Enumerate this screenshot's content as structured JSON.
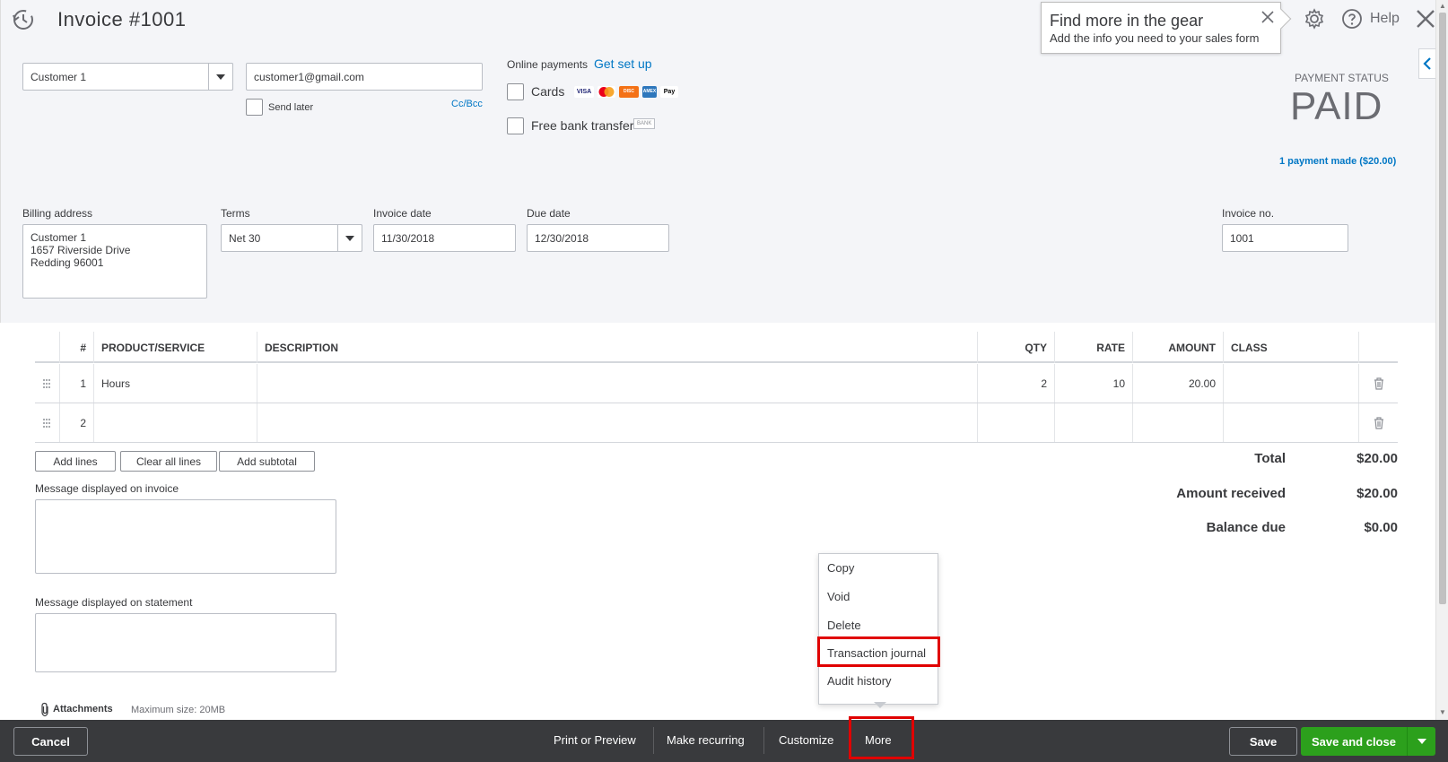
{
  "header": {
    "title": "Invoice #1001",
    "help_label": "Help"
  },
  "tooltip": {
    "title": "Find more in the gear",
    "body": "Add the info you need to your sales form"
  },
  "customer": {
    "selected": "Customer 1",
    "email": "customer1@gmail.com",
    "send_later_label": "Send later",
    "cc_bcc_label": "Cc/Bcc"
  },
  "online_payments": {
    "label": "Online payments",
    "setup_link": "Get set up",
    "cards_label": "Cards",
    "card_logos": [
      "VISA",
      "MC",
      "DISC",
      "AMEX",
      "Pay"
    ],
    "bank_label": "Free bank transfer",
    "bank_badge": "BANK"
  },
  "payment_status": {
    "label": "PAYMENT STATUS",
    "value": "PAID",
    "payments_link": "1 payment made ($20.00)"
  },
  "fields": {
    "billing_address_label": "Billing address",
    "billing_address_lines": [
      "Customer 1",
      "1657 Riverside Drive",
      "Redding  96001"
    ],
    "terms_label": "Terms",
    "terms_value": "Net 30",
    "invoice_date_label": "Invoice date",
    "invoice_date_value": "11/30/2018",
    "due_date_label": "Due date",
    "due_date_value": "12/30/2018",
    "invoice_no_label": "Invoice no.",
    "invoice_no_value": "1001"
  },
  "table": {
    "headers": {
      "num": "#",
      "product": "PRODUCT/SERVICE",
      "description": "DESCRIPTION",
      "qty": "QTY",
      "rate": "RATE",
      "amount": "AMOUNT",
      "class": "CLASS"
    },
    "rows": [
      {
        "num": "1",
        "product": "Hours",
        "description": "",
        "qty": "2",
        "rate": "10",
        "amount": "20.00",
        "class": ""
      },
      {
        "num": "2",
        "product": "",
        "description": "",
        "qty": "",
        "rate": "",
        "amount": "",
        "class": ""
      }
    ]
  },
  "line_buttons": {
    "add_lines": "Add lines",
    "clear_all_lines": "Clear all lines",
    "add_subtotal": "Add subtotal"
  },
  "messages": {
    "invoice_label": "Message displayed on invoice",
    "statement_label": "Message displayed on statement"
  },
  "attachments": {
    "label": "Attachments",
    "max_size": "Maximum size: 20MB"
  },
  "totals": {
    "total_label": "Total",
    "total_value": "$20.00",
    "received_label": "Amount received",
    "received_value": "$20.00",
    "balance_label": "Balance due",
    "balance_value": "$0.00"
  },
  "more_menu": {
    "items": [
      "Copy",
      "Void",
      "Delete",
      "Transaction journal",
      "Audit history"
    ]
  },
  "footer": {
    "cancel": "Cancel",
    "print_preview": "Print or Preview",
    "make_recurring": "Make recurring",
    "customize": "Customize",
    "more": "More",
    "save": "Save",
    "save_and_close": "Save and close"
  },
  "colors": {
    "accent_link": "#0077c5",
    "save_green": "#2ca01c",
    "footer_bg": "#393a3d",
    "highlight": "#e00000"
  }
}
